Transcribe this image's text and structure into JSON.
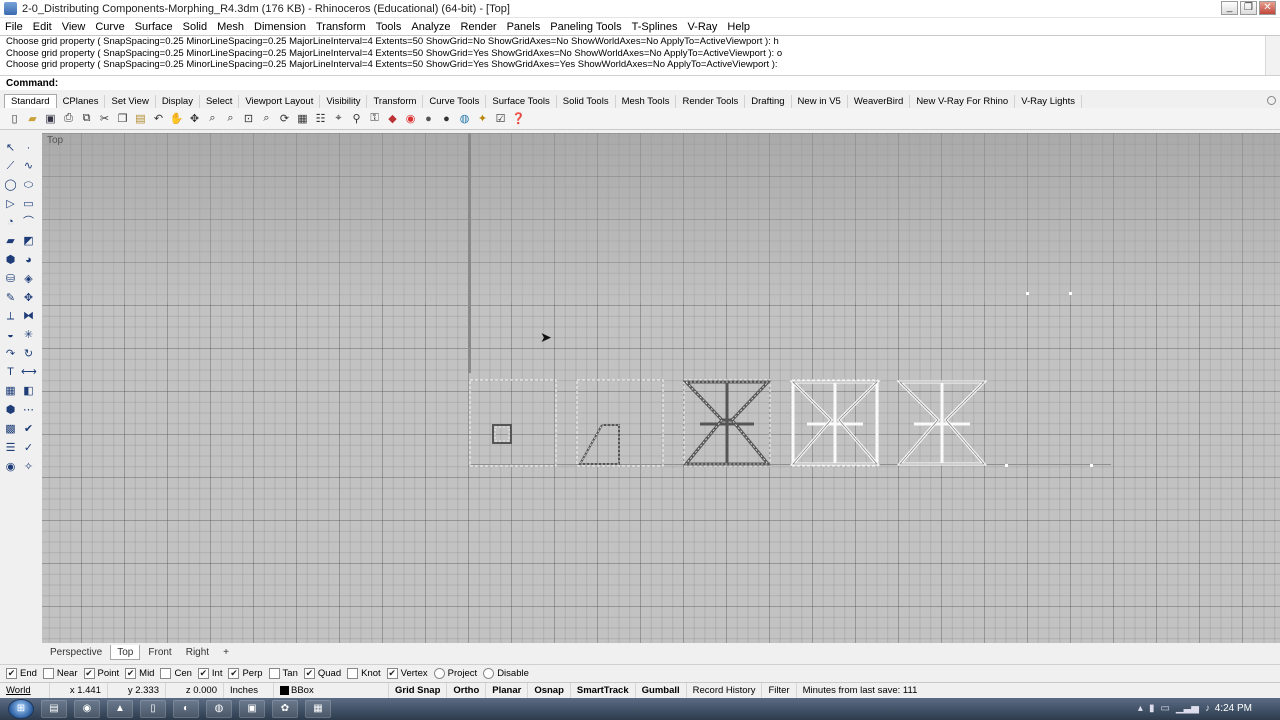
{
  "window": {
    "title": "2-0_Distributing Components-Morphing_R4.3dm (176 KB) - Rhinoceros (Educational) (64-bit) - [Top]",
    "controls": [
      "_",
      "❐",
      "✕"
    ]
  },
  "menu": [
    "File",
    "Edit",
    "View",
    "Curve",
    "Surface",
    "Solid",
    "Mesh",
    "Dimension",
    "Transform",
    "Tools",
    "Analyze",
    "Render",
    "Panels",
    "Paneling Tools",
    "T-Splines",
    "V-Ray",
    "Help"
  ],
  "history": [
    "Choose grid property ( SnapSpacing=0.25  MinorLineSpacing=0.25  MajorLineInterval=4  Extents=50  ShowGrid=No  ShowGridAxes=No  ShowWorldAxes=No  ApplyTo=ActiveViewport ): h",
    "Choose grid property ( SnapSpacing=0.25  MinorLineSpacing=0.25  MajorLineInterval=4  Extents=50  ShowGrid=Yes  ShowGridAxes=No  ShowWorldAxes=No  ApplyTo=ActiveViewport ): o",
    "Choose grid property ( SnapSpacing=0.25  MinorLineSpacing=0.25  MajorLineInterval=4  Extents=50  ShowGrid=Yes  ShowGridAxes=Yes  ShowWorldAxes=No  ApplyTo=ActiveViewport ):"
  ],
  "command": {
    "label": "Command:",
    "value": ""
  },
  "toolbar_tabs": [
    "Standard",
    "CPlanes",
    "Set View",
    "Display",
    "Select",
    "Viewport Layout",
    "Visibility",
    "Transform",
    "Curve Tools",
    "Surface Tools",
    "Solid Tools",
    "Mesh Tools",
    "Render Tools",
    "Drafting",
    "New in V5",
    "WeaverBird",
    "New V-Ray For Rhino",
    "V-Ray Lights"
  ],
  "active_toolbar_tab": "Standard",
  "toolbar_icons": [
    "new-icon",
    "open-icon",
    "save-icon",
    "print-icon",
    "import-icon",
    "cut-icon",
    "copy-icon",
    "paste-icon",
    "undo-icon",
    "pan-icon",
    "rotate-icon",
    "zoom-icon",
    "zoom-window-icon",
    "zoom-extents-icon",
    "zoom-selected-icon",
    "rotate-view-icon",
    "grid-icon",
    "properties-icon",
    "select-icon",
    "light-icon",
    "lock-icon",
    "render-icon",
    "color-wheel-icon",
    "material-icon",
    "sphere-icon",
    "globe-icon",
    "wand-icon",
    "options-icon",
    "help-icon"
  ],
  "viewport": {
    "label": "Top"
  },
  "viewport_tabs": [
    "Perspective",
    "Top",
    "Front",
    "Right",
    "+"
  ],
  "active_viewport_tab": "Top",
  "osnaps": [
    {
      "label": "End",
      "checked": true
    },
    {
      "label": "Near",
      "checked": false
    },
    {
      "label": "Point",
      "checked": true
    },
    {
      "label": "Mid",
      "checked": true
    },
    {
      "label": "Cen",
      "checked": false
    },
    {
      "label": "Int",
      "checked": true
    },
    {
      "label": "Perp",
      "checked": true
    },
    {
      "label": "Tan",
      "checked": false
    },
    {
      "label": "Quad",
      "checked": true
    },
    {
      "label": "Knot",
      "checked": false
    },
    {
      "label": "Vertex",
      "checked": true
    },
    {
      "label": "Project",
      "checked": false
    },
    {
      "label": "Disable",
      "checked": false
    }
  ],
  "status": {
    "cplane": "World",
    "x": "x 1.441",
    "y": "y 2.333",
    "z": "z 0.000",
    "units": "Inches",
    "layer": "BBox",
    "grid_snap": "Grid Snap",
    "ortho": "Ortho",
    "planar": "Planar",
    "osnap": "Osnap",
    "smarttrack": "SmartTrack",
    "gumball": "Gumball",
    "record_history": "Record History",
    "filter": "Filter",
    "autosave": "Minutes from last save: 111"
  },
  "taskbar": {
    "time": "4:24 PM"
  }
}
